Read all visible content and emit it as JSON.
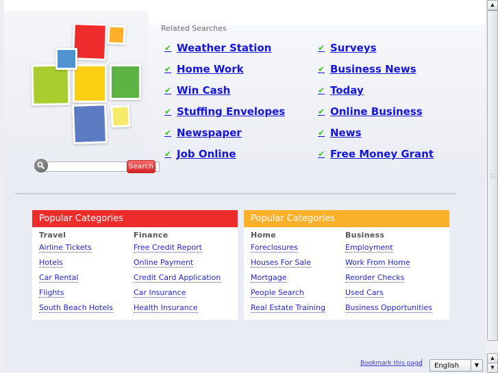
{
  "search": {
    "placeholder": "",
    "value": "",
    "button_label": "Search"
  },
  "related": {
    "title": "Related Searches",
    "left": [
      "Weather Station",
      "Home Work",
      "Win Cash",
      "Stuffing Envelopes",
      "Newspaper",
      "Job Online"
    ],
    "right": [
      "Surveys",
      "Business News",
      "Today",
      "Online Business",
      "News",
      "Free Money Grant"
    ]
  },
  "categories": [
    {
      "title": "Popular Categories",
      "color": "#ee2c2c",
      "columns": [
        {
          "title": "Travel",
          "links": [
            "Airline Tickets",
            "Hotels",
            "Car Rental",
            "Flights",
            "South Beach Hotels"
          ]
        },
        {
          "title": "Finance",
          "links": [
            "Free Credit Report",
            "Online Payment",
            "Credit Card Application",
            "Car Insurance",
            "Health Insurance"
          ]
        }
      ]
    },
    {
      "title": "Popular Categories",
      "color": "#fbb02a",
      "columns": [
        {
          "title": "Home",
          "links": [
            "Foreclosures",
            "Houses For Sale",
            "Mortgage",
            "People Search",
            "Real Estate Training"
          ]
        },
        {
          "title": "Business",
          "links": [
            "Employment",
            "Work From Home",
            "Reorder Checks",
            "Used Cars",
            "Business Opportunities"
          ]
        }
      ]
    }
  ],
  "footer": {
    "bookmark_label": "Bookmark this page",
    "separator": "|",
    "language_selected": "English"
  },
  "icons": {
    "check": "✔",
    "arrow_up": "▲",
    "arrow_down": "▼"
  },
  "colors": {
    "link": "#1515d8",
    "check": "#3cbf2a",
    "search_button": "#e03030"
  }
}
